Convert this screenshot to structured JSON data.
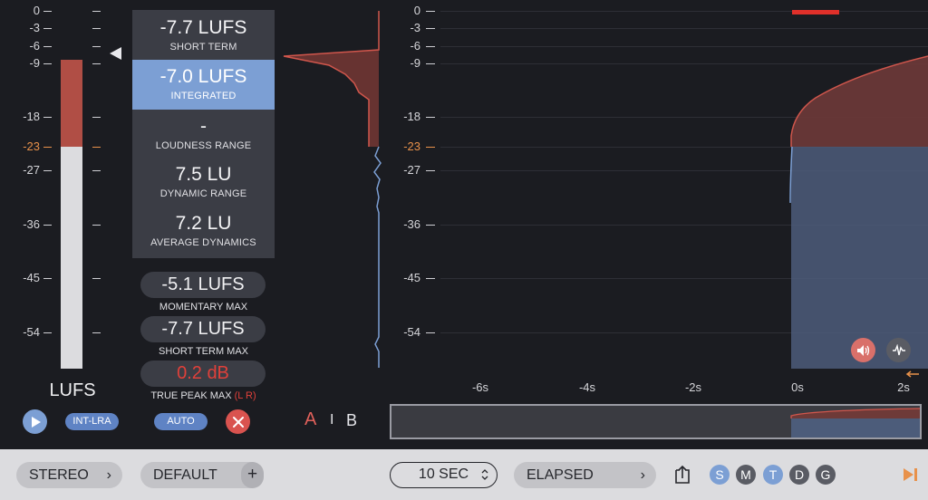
{
  "meter": {
    "scale": [
      "0",
      "-3",
      "-6",
      "-9",
      "-18",
      "-23",
      "-27",
      "-36",
      "-45",
      "-54"
    ],
    "target_label": "-23",
    "units": "LUFS",
    "integrated_level": -7.0
  },
  "readouts": {
    "short_term": {
      "value": "-7.7 LUFS",
      "label": "SHORT TERM"
    },
    "integrated": {
      "value": "-7.0 LUFS",
      "label": "INTEGRATED"
    },
    "loudness_range": {
      "value": "-",
      "label": "LOUDNESS RANGE"
    },
    "dynamic_range": {
      "value": "7.5 LU",
      "label": "DYNAMIC RANGE"
    },
    "average_dynamics": {
      "value": "7.2 LU",
      "label": "AVERAGE DYNAMICS"
    },
    "momentary_max": {
      "value": "-5.1 LUFS",
      "label": "MOMENTARY MAX"
    },
    "short_term_max": {
      "value": "-7.7 LUFS",
      "label": "SHORT TERM MAX"
    },
    "true_peak_max": {
      "value": "0.2 dB",
      "label": "TRUE PEAK MAX",
      "channels": "(L R)"
    }
  },
  "controls": {
    "int_lra": "INT-LRA",
    "auto": "AUTO",
    "a_label": "A",
    "separator": "I",
    "b_label": "B"
  },
  "graph": {
    "scale": [
      "0",
      "-3",
      "-6",
      "-9",
      "-18",
      "-23",
      "-27",
      "-36",
      "-45",
      "-54"
    ],
    "time_labels": [
      "-6s",
      "-4s",
      "-2s",
      "0s",
      "2s"
    ]
  },
  "footer": {
    "channel_mode": "STEREO",
    "preset": "DEFAULT",
    "add_symbol": "+",
    "duration": "10 SEC",
    "time_mode": "ELAPSED",
    "modes": [
      "S",
      "M",
      "T",
      "D",
      "G"
    ],
    "chevron": "›"
  },
  "colors": {
    "accent_blue": "#7c9fd4",
    "loud_red": "#b04e45",
    "target_orange": "#e8914a",
    "panel": "#3b3d45"
  }
}
